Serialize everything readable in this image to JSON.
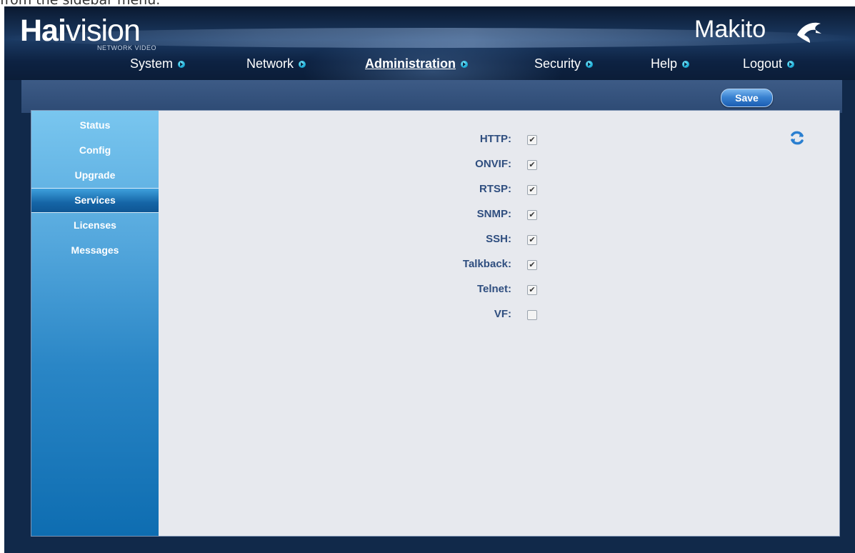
{
  "caption": "from the sidebar menu.",
  "header": {
    "logo_brand_bold": "Hai",
    "logo_brand_rest": "vision",
    "logo_tagline": "NETWORK VIDEO",
    "product_name": "Makito"
  },
  "nav": {
    "items": [
      {
        "label": "System"
      },
      {
        "label": "Network"
      },
      {
        "label": "Administration"
      },
      {
        "label": "Security"
      },
      {
        "label": "Help"
      },
      {
        "label": "Logout"
      }
    ],
    "active": "Administration"
  },
  "toolbar": {
    "save_label": "Save"
  },
  "sidebar": {
    "items": [
      {
        "label": "Status"
      },
      {
        "label": "Config"
      },
      {
        "label": "Upgrade"
      },
      {
        "label": "Services"
      },
      {
        "label": "Licenses"
      },
      {
        "label": "Messages"
      }
    ],
    "active": "Services"
  },
  "services": [
    {
      "label": "HTTP:",
      "checked": true
    },
    {
      "label": "ONVIF:",
      "checked": true
    },
    {
      "label": "RTSP:",
      "checked": true
    },
    {
      "label": "SNMP:",
      "checked": true
    },
    {
      "label": "SSH:",
      "checked": true
    },
    {
      "label": "Talkback:",
      "checked": true
    },
    {
      "label": "Telnet:",
      "checked": true
    },
    {
      "label": "VF:",
      "checked": false
    }
  ],
  "icons": {
    "refresh": "refresh-icon",
    "nav_arrow": "arrow-bullet-icon",
    "logo": "shark-logo-icon"
  },
  "colors": {
    "header_bg": "#11294a",
    "accent_dot": "#25b5dd",
    "label_text": "#2f4e7f",
    "sidebar_top": "#79c6ef",
    "sidebar_bottom": "#0e6db1",
    "content_bg": "#e7e9ee"
  }
}
